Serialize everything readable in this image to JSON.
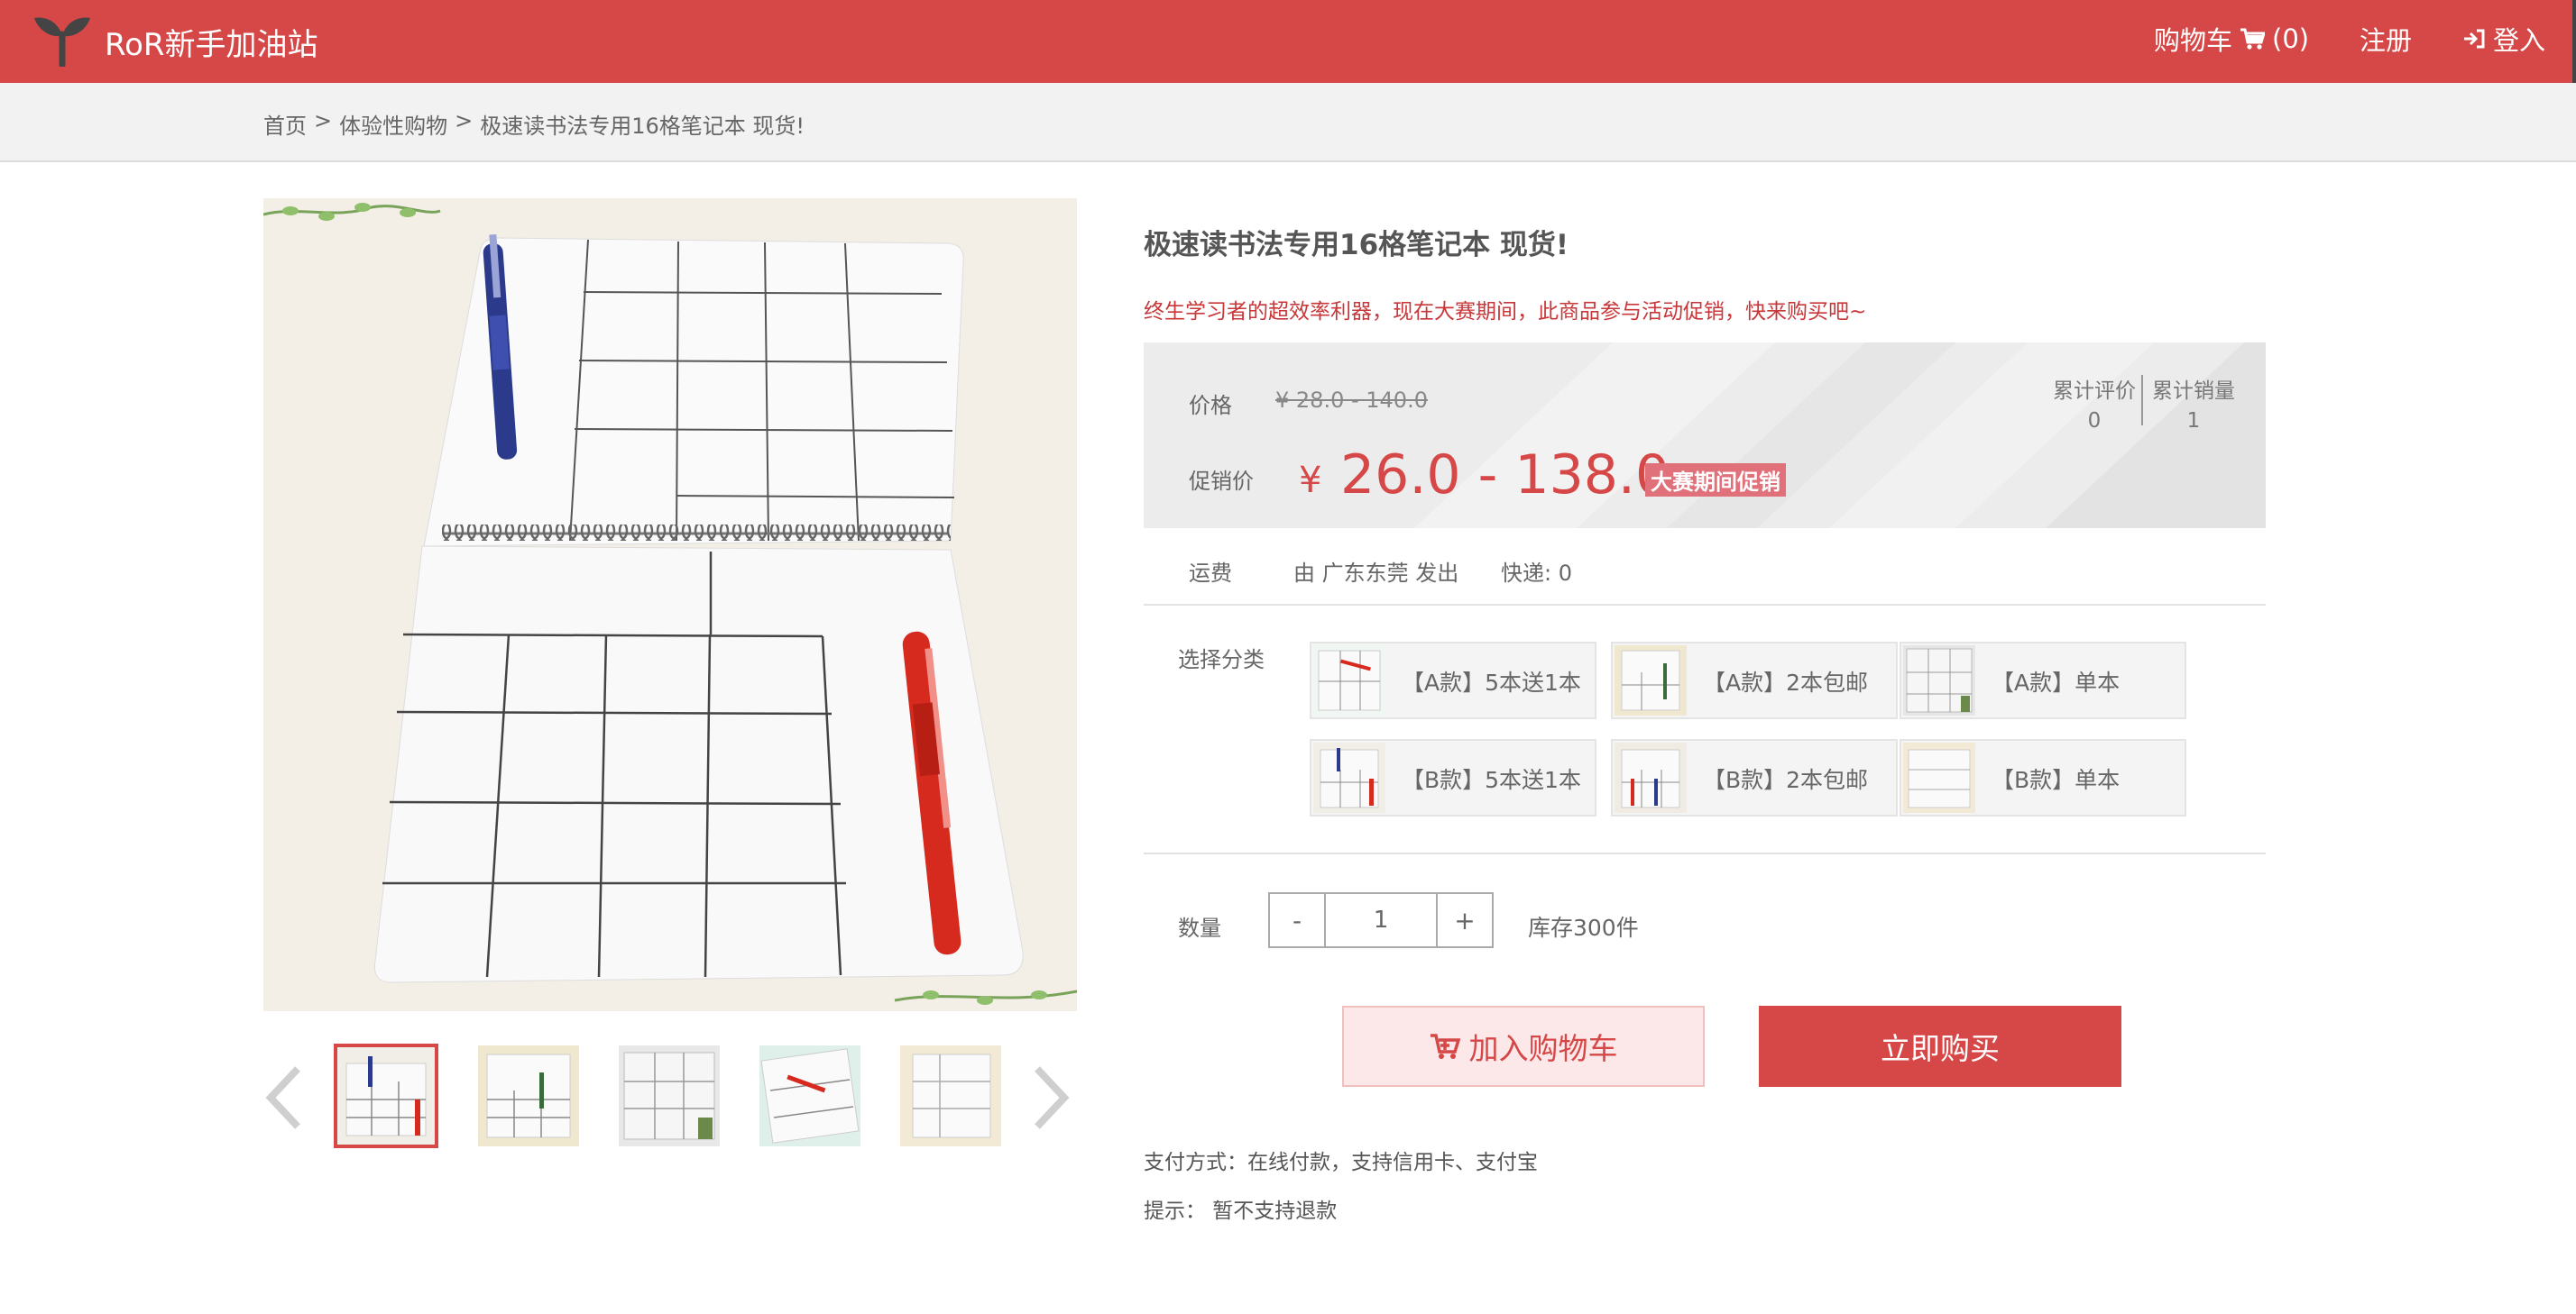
{
  "header": {
    "brand": "RoR新手加油站",
    "cart_label": "购物车",
    "cart_count": "(0)",
    "register_label": "注册",
    "login_label": "登入",
    "colors": {
      "primary": "#d64747"
    }
  },
  "breadcrumb": {
    "items": [
      "首页",
      "体验性购物",
      "极速读书法专用16格笔记本 现货!"
    ],
    "separator": ">"
  },
  "gallery": {
    "thumbnails_count": 5,
    "active_index": 0
  },
  "product": {
    "title": "极速读书法专用16格笔记本 现货!",
    "subtitle": "终生学习者的超效率利器，现在大赛期间，此商品参与活动促销，快来购买吧~",
    "price_label": "价格",
    "original_price": "¥ 28.0 - 140.0",
    "promo_label": "促销价",
    "promo_currency": "¥",
    "promo_price": "26.0 - 138.0",
    "promo_badge": "大赛期间促销",
    "reviews_label": "累计评价",
    "reviews_count": "0",
    "sales_label": "累计销量",
    "sales_count": "1",
    "shipping_label": "运费",
    "shipping_from": "由 广东东莞 发出",
    "shipping_express": "快递: 0",
    "variant_label": "选择分类",
    "variants": [
      {
        "label": "【A款】5本送1本"
      },
      {
        "label": "【A款】2本包邮"
      },
      {
        "label": "【A款】单本"
      },
      {
        "label": "【B款】5本送1本"
      },
      {
        "label": "【B款】2本包邮"
      },
      {
        "label": "【B款】单本"
      }
    ],
    "quantity_label": "数量",
    "quantity_minus": "-",
    "quantity_value": "1",
    "quantity_plus": "+",
    "stock": "库存300件",
    "add_to_cart": "加入购物车",
    "buy_now": "立即购买",
    "payment": "支付方式：在线付款，支持信用卡、支付宝",
    "tip": "提示： 暂不支持退款"
  }
}
